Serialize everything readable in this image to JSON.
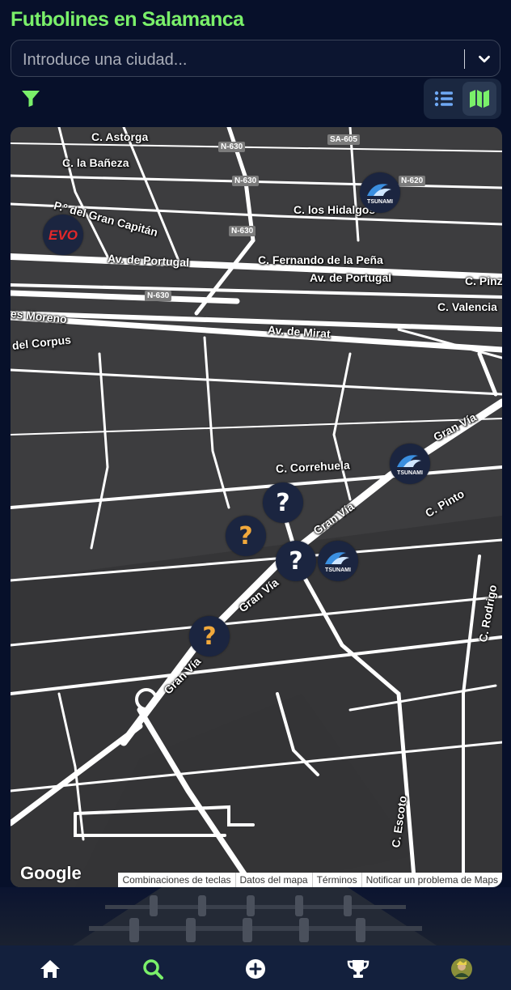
{
  "header": {
    "title": "Futbolines en Salamanca"
  },
  "search": {
    "placeholder": "Introduce una ciudad..."
  },
  "colors": {
    "accent": "#7af06a",
    "background": "#07102a",
    "marker": "#1b2540",
    "question": "#f2a93b"
  },
  "view_toggle": {
    "list_icon": "list-icon",
    "map_icon": "map-icon",
    "active": "map"
  },
  "map": {
    "streets": [
      {
        "label": "C. Astorga"
      },
      {
        "label": "C. la Bañeza"
      },
      {
        "label": "P.º del Gran Capitán"
      },
      {
        "label": "Av. de Portugal"
      },
      {
        "label": "C. Fernando de la Peña"
      },
      {
        "label": "Av. de Portugal"
      },
      {
        "label": "C. los Hidalgos"
      },
      {
        "label": "C. Pinz"
      },
      {
        "label": "C. Valencia"
      },
      {
        "label": "es Moreno"
      },
      {
        "label": "Av. de Mirat"
      },
      {
        "label": "del Corpus"
      },
      {
        "label": "C. Correhuela"
      },
      {
        "label": "Gran Vía"
      },
      {
        "label": "C. Pinto"
      },
      {
        "label": "Gran Vía"
      },
      {
        "label": "Gran Vía"
      },
      {
        "label": "Gran Vía"
      },
      {
        "label": "C. Rodrigo"
      },
      {
        "label": "C. Escoto"
      }
    ],
    "shields": [
      "N-630",
      "N-630",
      "N-630",
      "N-630",
      "SA-605",
      "N-620"
    ],
    "markers": [
      {
        "type": "brand",
        "label": "EVO"
      },
      {
        "type": "brand",
        "label": "TSUNAMI"
      },
      {
        "type": "brand",
        "label": "TSUNAMI"
      },
      {
        "type": "brand",
        "label": "TSUNAMI"
      },
      {
        "type": "unknown",
        "label": "?"
      },
      {
        "type": "unknown",
        "label": "?"
      },
      {
        "type": "unknown",
        "label": "?"
      },
      {
        "type": "unknown",
        "label": "?"
      }
    ],
    "google_logo": "Google",
    "attribution": [
      "Combinaciones de teclas",
      "Datos del mapa",
      "Términos",
      "Notificar un problema de Maps"
    ]
  },
  "bottom_nav": [
    {
      "icon": "home-icon",
      "active": false
    },
    {
      "icon": "search-icon",
      "active": true
    },
    {
      "icon": "add-icon",
      "active": false
    },
    {
      "icon": "trophy-icon",
      "active": false
    },
    {
      "icon": "avatar-icon",
      "active": false
    }
  ]
}
